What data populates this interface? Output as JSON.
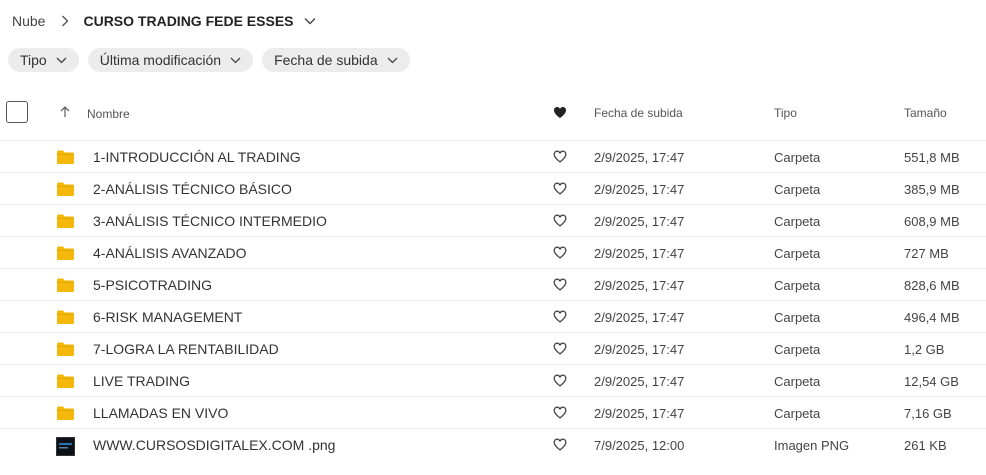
{
  "breadcrumb": {
    "root": "Nube",
    "current": "CURSO TRADING FEDE ESSES"
  },
  "filters": [
    {
      "label": "Tipo"
    },
    {
      "label": "Última modificación"
    },
    {
      "label": "Fecha de subida"
    }
  ],
  "columns": {
    "name": "Nombre",
    "date": "Fecha de subida",
    "type": "Tipo",
    "size": "Tamaño"
  },
  "files": [
    {
      "name": "1-INTRODUCCIÓN AL TRADING",
      "date": "2/9/2025, 17:47",
      "type": "Carpeta",
      "size": "551,8 MB",
      "icon": "folder-icon"
    },
    {
      "name": "2-ANÁLISIS TÉCNICO BÁSICO",
      "date": "2/9/2025, 17:47",
      "type": "Carpeta",
      "size": "385,9 MB",
      "icon": "folder-icon"
    },
    {
      "name": "3-ANÁLISIS TÉCNICO INTERMEDIO",
      "date": "2/9/2025, 17:47",
      "type": "Carpeta",
      "size": "608,9 MB",
      "icon": "folder-icon"
    },
    {
      "name": "4-ANÁLISIS AVANZADO",
      "date": "2/9/2025, 17:47",
      "type": "Carpeta",
      "size": "727 MB",
      "icon": "folder-icon"
    },
    {
      "name": "5-PSICOTRADING",
      "date": "2/9/2025, 17:47",
      "type": "Carpeta",
      "size": "828,6 MB",
      "icon": "folder-icon"
    },
    {
      "name": "6-RISK MANAGEMENT",
      "date": "2/9/2025, 17:47",
      "type": "Carpeta",
      "size": "496,4 MB",
      "icon": "folder-icon"
    },
    {
      "name": "7-LOGRA LA RENTABILIDAD",
      "date": "2/9/2025, 17:47",
      "type": "Carpeta",
      "size": "1,2 GB",
      "icon": "folder-icon"
    },
    {
      "name": "LIVE TRADING",
      "date": "2/9/2025, 17:47",
      "type": "Carpeta",
      "size": "12,54 GB",
      "icon": "folder-icon"
    },
    {
      "name": "LLAMADAS EN VIVO",
      "date": "2/9/2025, 17:47",
      "type": "Carpeta",
      "size": "7,16 GB",
      "icon": "folder-icon"
    },
    {
      "name": "WWW.CURSOSDIGITALEX.COM .png",
      "date": "7/9/2025, 12:00",
      "type": "Imagen PNG",
      "size": "261 KB",
      "icon": "image-thumbnail-icon"
    }
  ],
  "colors": {
    "folder": "#f5b70a",
    "folder_tab": "#e6a800",
    "chip_bg": "#ececec",
    "row_border": "#ededed"
  }
}
